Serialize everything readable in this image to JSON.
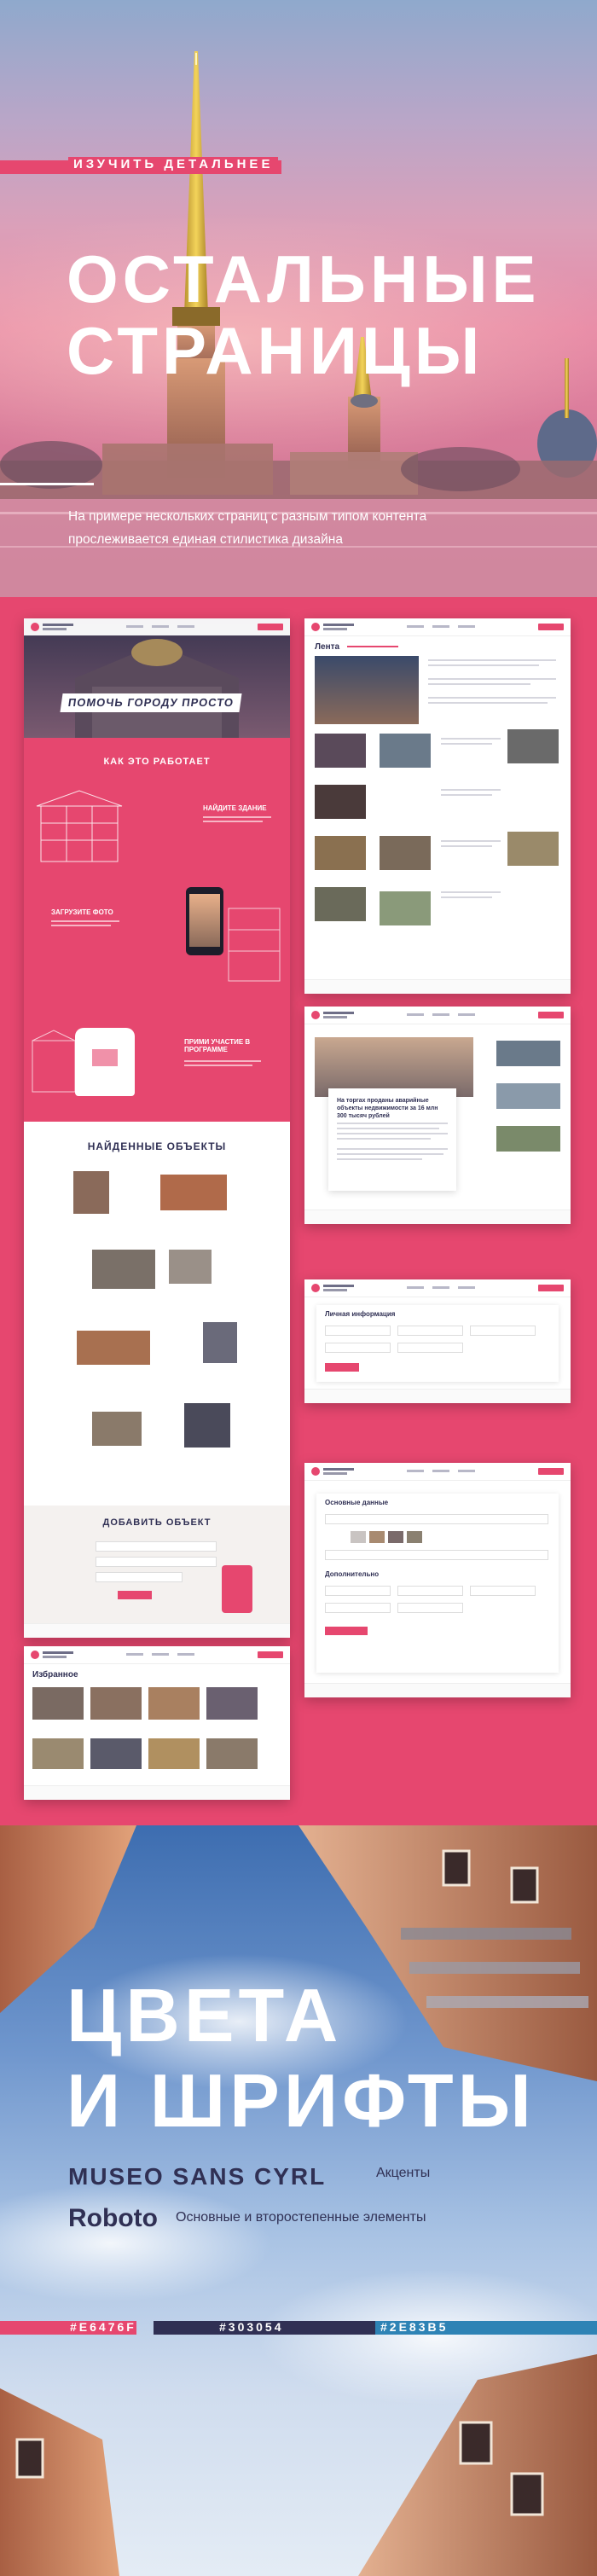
{
  "hero": {
    "tag_label": "Изучить детальнее",
    "title_line1": "Остальные",
    "title_line2": "страницы",
    "subtitle_line1": "На примере нескольких страниц с разным типом контента",
    "subtitle_line2": "прослеживается единая стилистика дизайна"
  },
  "mockups": {
    "landing": {
      "banner_text": "ПОМОЧЬ ГОРОДУ ПРОСТО",
      "how_title": "КАК ЭТО РАБОТАЕТ",
      "step1": "НАЙДИТЕ ЗДАНИЕ",
      "step2": "ЗАГРУЗИТЕ ФОТО",
      "step3": "ПРИМИ УЧАСТИЕ В ПРОГРАММЕ"
    },
    "found": {
      "title": "НАЙДЕННЫЕ ОБЪЕКТЫ",
      "add_title": "ДОБАВИТЬ ОБЪЕКТ"
    },
    "feed": {
      "title": "Лента"
    },
    "article": {
      "headline": "На торгах проданы аварийные объекты недвижимости за 16 млн 300 тысяч рублей"
    },
    "form1": {
      "title": "Личная информация"
    },
    "form2": {
      "title": "Основные данные",
      "section2": "Дополнительно"
    },
    "favorites": {
      "title": "Избранное"
    }
  },
  "colors_fonts": {
    "title_line1": "Цвета",
    "title_line2": "и шрифты",
    "font1_name": "MUSEO SANS CYRL",
    "font1_desc": "Акценты",
    "font2_name": "Roboto",
    "font2_desc": "Основные и второстепенные элементы",
    "swatches": [
      {
        "label": "#E6476F",
        "color": "#e6476f"
      },
      {
        "label": "#303054",
        "color": "#303054"
      },
      {
        "label": "#2E83B5",
        "color": "#2e83b5"
      }
    ]
  }
}
